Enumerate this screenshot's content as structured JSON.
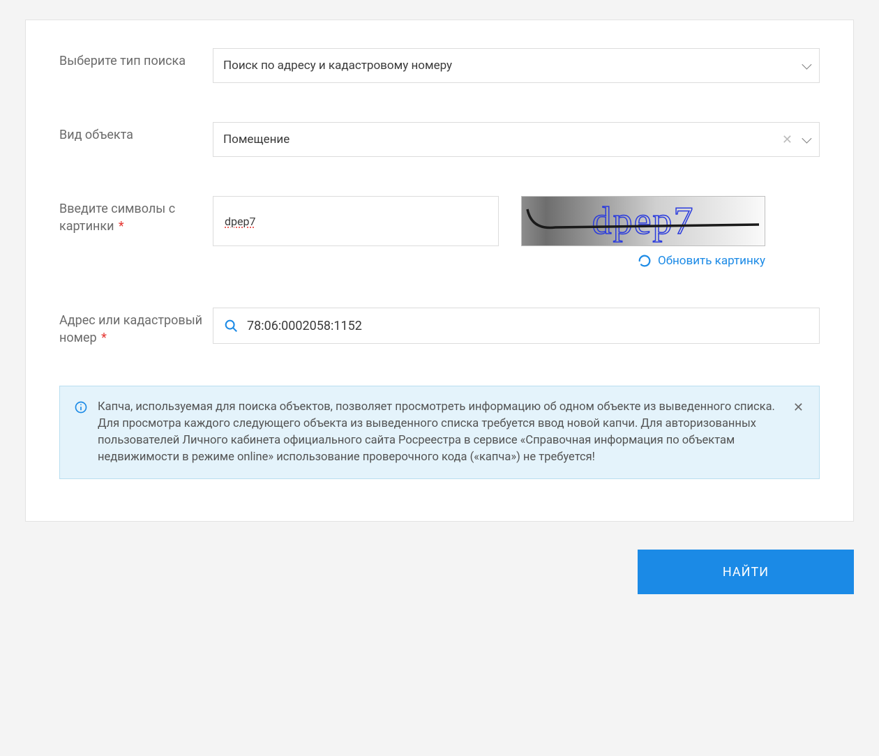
{
  "form": {
    "search_type": {
      "label": "Выберите тип поиска",
      "value": "Поиск по адресу и кадастровому номеру"
    },
    "object_kind": {
      "label": "Вид объекта",
      "value": "Помещение"
    },
    "captcha": {
      "label": "Введите символы с картинки",
      "input_value": "dpep7",
      "image_text": "dpep7",
      "refresh_label": "Обновить картинку"
    },
    "address": {
      "label": "Адрес или кадастровый номер",
      "value": "78:06:0002058:1152"
    }
  },
  "info": {
    "text": "Капча, используемая для поиска объектов, позволяет просмотреть информацию об одном объекте из выведенного списка. Для просмотра каждого следующего объекта из выведенного списка требуется ввод новой капчи. Для авторизованных пользователей Личного кабинета официального сайта Росреестра в сервисе «Справочная информация по объектам недвижимости в режиме online» использование проверочного кода («капча») не требуется!"
  },
  "actions": {
    "submit_label": "НАЙТИ"
  },
  "colors": {
    "accent": "#1b8ae6",
    "required": "#e53935"
  }
}
